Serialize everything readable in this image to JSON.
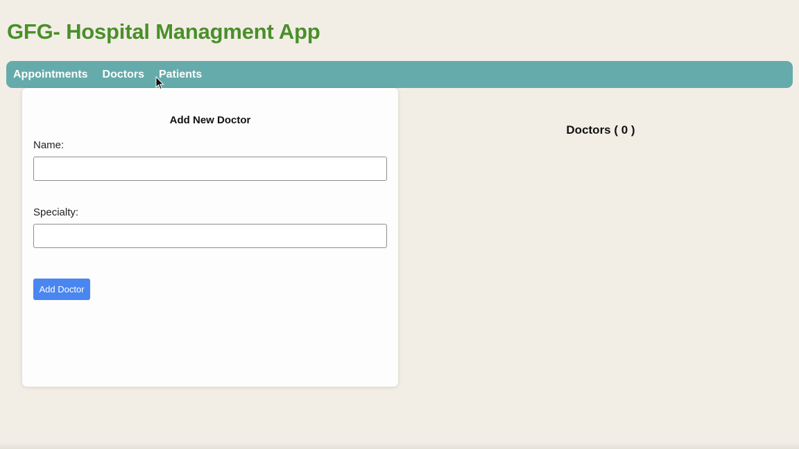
{
  "app": {
    "title": "GFG- Hospital Managment App"
  },
  "nav": {
    "items": [
      {
        "label": "Appointments"
      },
      {
        "label": "Doctors"
      },
      {
        "label": "Patients"
      }
    ]
  },
  "form": {
    "heading": "Add New Doctor",
    "name_label": "Name:",
    "name_value": "",
    "specialty_label": "Specialty:",
    "specialty_value": "",
    "submit_label": "Add Doctor"
  },
  "doctors_list": {
    "heading": "Doctors ( 0 )"
  },
  "colors": {
    "title": "#4a8f2a",
    "navbar": "#66abab",
    "button": "#4a86f0",
    "background": "#f2eee6"
  },
  "icons": {
    "cursor": "mouse-pointer-icon"
  }
}
